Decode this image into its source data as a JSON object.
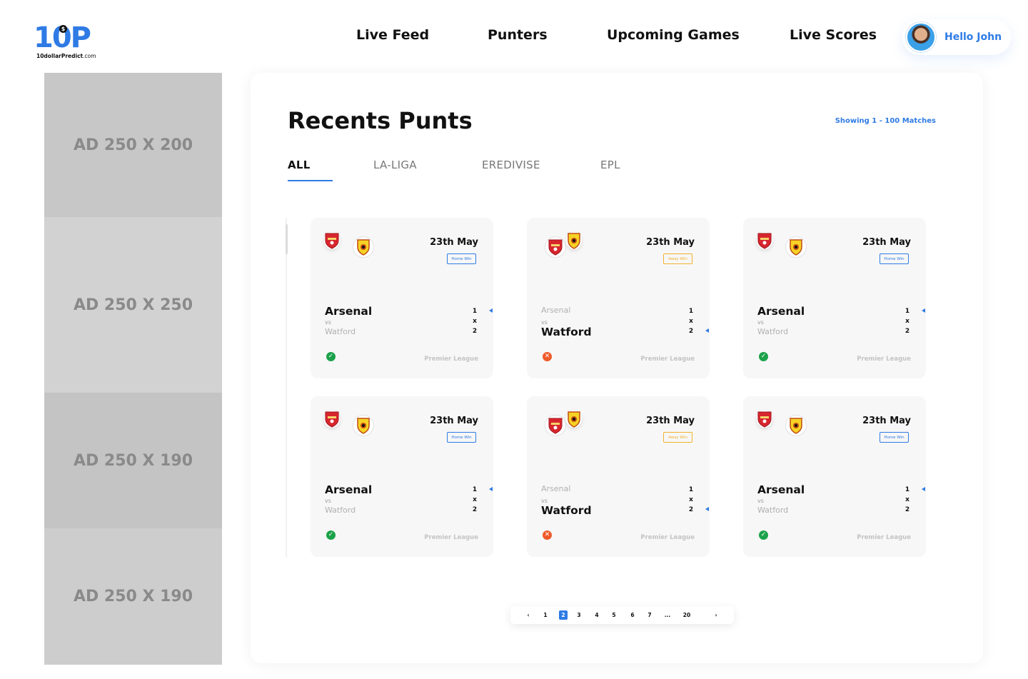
{
  "brand": {
    "logo_text": "10P",
    "logo_coin": "$",
    "tagline": "10dollarPredict",
    "domain": ".com"
  },
  "nav": {
    "items": [
      {
        "label": "Live Feed"
      },
      {
        "label": "Punters"
      },
      {
        "label": "Upcoming Games"
      },
      {
        "label": "Live Scores"
      }
    ],
    "user_greeting": "Hello John"
  },
  "ads": [
    {
      "label": "AD 250 X 200"
    },
    {
      "label": "AD 250 X 250"
    },
    {
      "label": "AD 250 X 190"
    },
    {
      "label": "AD 250 X 190"
    }
  ],
  "main": {
    "title": "Recents Punts",
    "showing": "Showing 1 - 100 Matches",
    "tabs": [
      {
        "label": "ALL",
        "active": true
      },
      {
        "label": "LA-LIGA",
        "active": false
      },
      {
        "label": "EREDIVISE",
        "active": false
      },
      {
        "label": "EPL",
        "active": false
      }
    ]
  },
  "odds": [
    "1",
    "x",
    "2"
  ],
  "cards": [
    {
      "date": "23th May",
      "badge": "Home Win",
      "badge_type": "home",
      "home": "Arsenal",
      "vs": "vs",
      "away": "Watford",
      "pick": "home",
      "status": "win",
      "status_icon": "✓",
      "league": "Premier League"
    },
    {
      "date": "23th May",
      "badge": "Away Win",
      "badge_type": "away",
      "home": "Arsenal",
      "vs": "vs",
      "away": "Watford",
      "pick": "away",
      "status": "loss",
      "status_icon": "✕",
      "league": "Premier League"
    },
    {
      "date": "23th May",
      "badge": "Home Win",
      "badge_type": "home",
      "home": "Arsenal",
      "vs": "vs",
      "away": "Watford",
      "pick": "home",
      "status": "win",
      "status_icon": "✓",
      "league": "Premier League"
    },
    {
      "date": "23th May",
      "badge": "Home Win",
      "badge_type": "home",
      "home": "Arsenal",
      "vs": "vs",
      "away": "Watford",
      "pick": "home",
      "status": "win",
      "status_icon": "✓",
      "league": "Premier League"
    },
    {
      "date": "23th May",
      "badge": "Away Win",
      "badge_type": "away",
      "home": "Arsenal",
      "vs": "vs",
      "away": "Watford",
      "pick": "away",
      "status": "loss",
      "status_icon": "✕",
      "league": "Premier League"
    },
    {
      "date": "23th May",
      "badge": "Home Win",
      "badge_type": "home",
      "home": "Arsenal",
      "vs": "vs",
      "away": "Watford",
      "pick": "home",
      "status": "win",
      "status_icon": "✓",
      "league": "Premier League"
    }
  ],
  "pagination": {
    "prev": "‹",
    "next": "›",
    "pages": [
      "1",
      "2",
      "3",
      "4",
      "5",
      "6",
      "7",
      "...",
      "20"
    ],
    "current": "2"
  },
  "colors": {
    "accent": "#2f7be5",
    "win": "#1ca24a",
    "loss": "#ef5a2a",
    "away_badge": "#f2b230"
  }
}
